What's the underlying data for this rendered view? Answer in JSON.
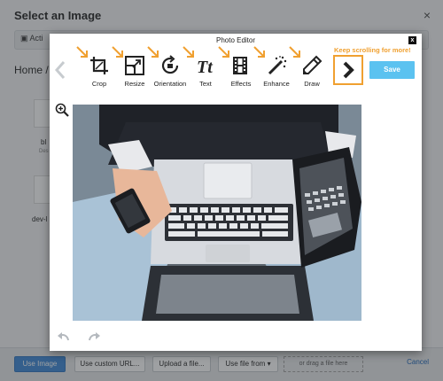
{
  "background_dialog": {
    "title": "Select an Image",
    "close_symbol": "×",
    "actions_label": "Acti",
    "breadcrumb": "Home /",
    "items": [
      {
        "name": "bl",
        "sub": "Des"
      },
      {
        "name": "dev-l",
        "sub": ""
      }
    ],
    "footer": {
      "use_image": "Use Image",
      "use_custom_url": "Use custom URL...",
      "upload_file": "Upload a file...",
      "use_file_from": "Use file from",
      "drop_hint": "or drag a file here",
      "cancel": "Cancel"
    }
  },
  "editor": {
    "title": "Photo Editor",
    "close_symbol": "x",
    "tools": [
      {
        "label": "Crop",
        "icon": "crop-icon"
      },
      {
        "label": "Resize",
        "icon": "resize-icon"
      },
      {
        "label": "Orientation",
        "icon": "rotate-icon"
      },
      {
        "label": "Text",
        "icon": "text-icon"
      },
      {
        "label": "Effects",
        "icon": "film-icon"
      },
      {
        "label": "Enhance",
        "icon": "magic-wand-icon"
      },
      {
        "label": "Draw",
        "icon": "pencil-icon"
      }
    ],
    "scroll_hint": "Keep scrolling for more!",
    "save_label": "Save",
    "accent_color": "#f0a030",
    "save_color": "#5bc2f0"
  }
}
